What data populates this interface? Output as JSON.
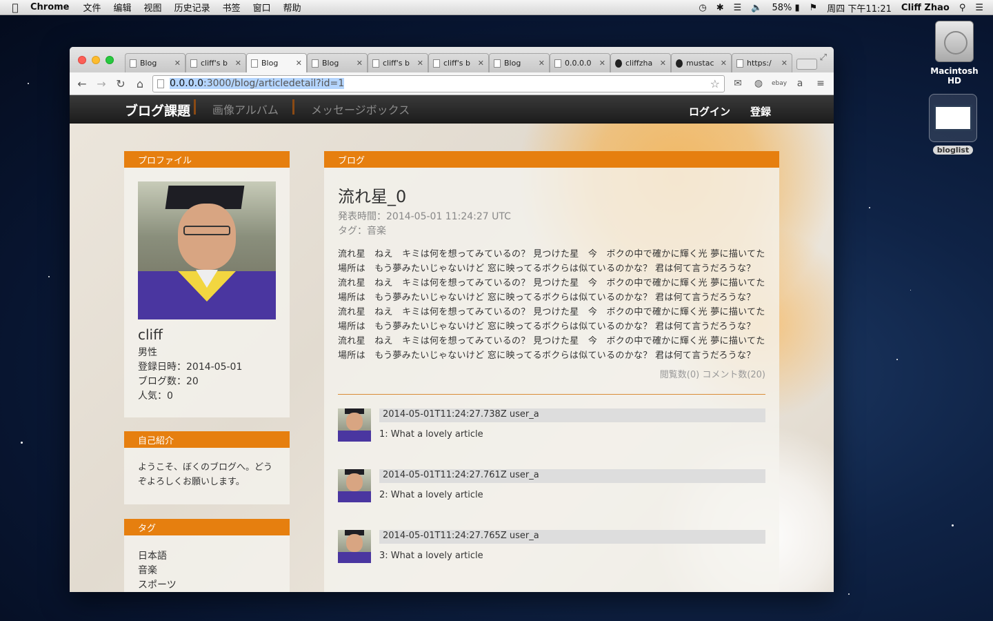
{
  "menubar": {
    "apple": "",
    "app": "Chrome",
    "items": [
      "文件",
      "编辑",
      "视图",
      "历史记录",
      "书签",
      "窗口",
      "帮助"
    ],
    "battery": "58%",
    "datetime": "周四 下午11:21",
    "user": "Cliff Zhao"
  },
  "desktop": {
    "hd_label": "Macintosh HD",
    "bloglist_label": "bloglist"
  },
  "browser": {
    "tabs": [
      {
        "title": "Blog",
        "active": false
      },
      {
        "title": "cliff's b",
        "active": false
      },
      {
        "title": "Blog",
        "active": true
      },
      {
        "title": "Blog",
        "active": false
      },
      {
        "title": "cliff's b",
        "active": false
      },
      {
        "title": "cliff's b",
        "active": false
      },
      {
        "title": "Blog",
        "active": false
      },
      {
        "title": "0.0.0.0",
        "active": false
      },
      {
        "title": "cliffzha",
        "active": false
      },
      {
        "title": "mustac",
        "active": false
      },
      {
        "title": "https:/",
        "active": false
      }
    ],
    "url_host": "0.0.0.0",
    "url_path": ":3000/blog/articledetail?id=1"
  },
  "nav": {
    "brand": "ブログ課題",
    "album": "画像アルバム",
    "messages": "メッセージボックス",
    "login": "ログイン",
    "register": "登録"
  },
  "profile": {
    "heading": "プロファイル",
    "name": "cliff",
    "gender": "男性",
    "registered": "登録日時：2014-05-01",
    "blog_count": "ブログ数：20",
    "popularity": "人気：0"
  },
  "intro": {
    "heading": "自己紹介",
    "text": "ようこそ、ぼくのブログへ。どうぞよろしくお願いします。"
  },
  "tags": {
    "heading": "タグ",
    "items": [
      "日本語",
      "音楽",
      "スポーツ"
    ]
  },
  "blog": {
    "heading": "ブログ",
    "title": "流れ星_0",
    "published": "発表時間：2014-05-01 11:24:27 UTC",
    "tag": "タグ：音楽",
    "body": "流れ星　ねえ　キミは何を想ってみているの？ 見つけた星　今　ボクの中で確かに輝く光 夢に描いてた場所は　もう夢みたいじゃないけど 窓に映ってるボクらは似ているのかな？ 君は何て言うだろうな？ 流れ星　ねえ　キミは何を想ってみているの？ 見つけた星　今　ボクの中で確かに輝く光 夢に描いてた場所は　もう夢みたいじゃないけど 窓に映ってるボクらは似ているのかな？ 君は何て言うだろうな？ 流れ星　ねえ　キミは何を想ってみているの？ 見つけた星　今　ボクの中で確かに輝く光 夢に描いてた場所は　もう夢みたいじゃないけど 窓に映ってるボクらは似ているのかな？ 君は何て言うだろうな？ 流れ星　ねえ　キミは何を想ってみているの？ 見つけた星　今　ボクの中で確かに輝く光 夢に描いてた場所は　もう夢みたいじゃないけど 窓に映ってるボクらは似ているのかな？ 君は何て言うだろうな？",
    "views": "閲覧数(0)",
    "comments_count": "コメント数(20)"
  },
  "comments": [
    {
      "header": "2014-05-01T11:24:27.738Z user_a",
      "text": "1: What a lovely article"
    },
    {
      "header": "2014-05-01T11:24:27.761Z user_a",
      "text": "2: What a lovely article"
    },
    {
      "header": "2014-05-01T11:24:27.765Z user_a",
      "text": "3: What a lovely article"
    }
  ]
}
